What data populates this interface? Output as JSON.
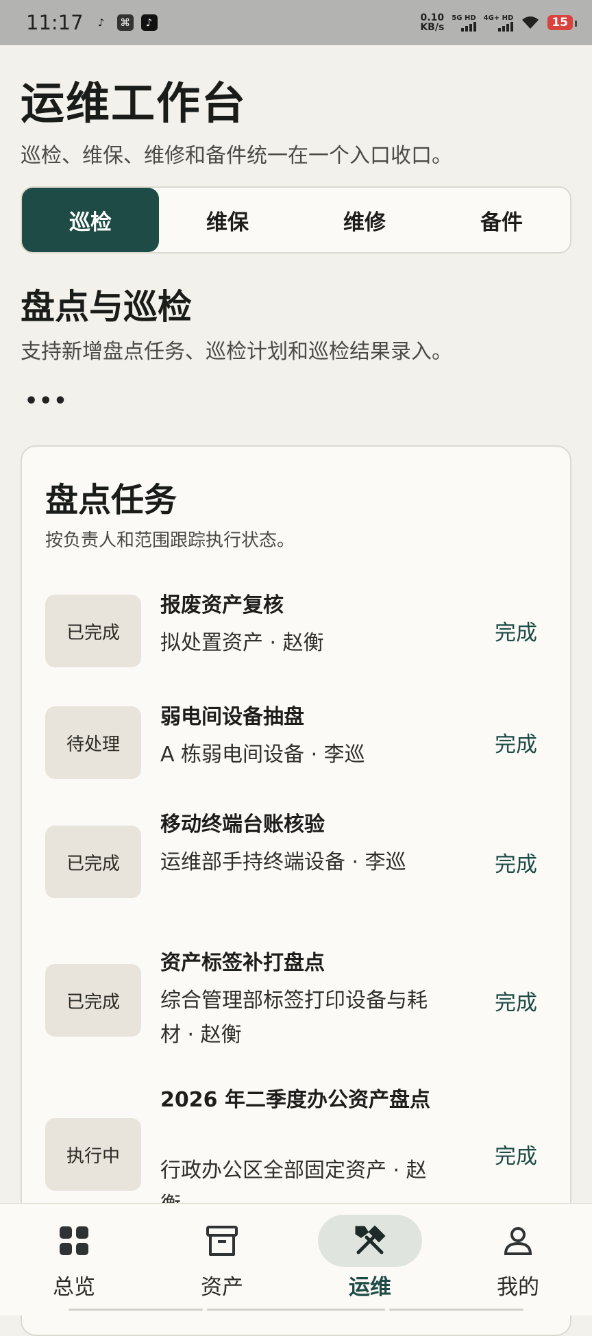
{
  "status_bar": {
    "time": "11:17",
    "net_speed_value": "0.10",
    "net_speed_unit": "KB/s",
    "sim1": "5G HD",
    "sim2": "4G+ HD",
    "battery": "15"
  },
  "page": {
    "title": "运维工作台",
    "subtitle": "巡检、维保、维修和备件统一在一个入口收口。"
  },
  "tabs": [
    {
      "label": "巡检",
      "active": true
    },
    {
      "label": "维保",
      "active": false
    },
    {
      "label": "维修",
      "active": false
    },
    {
      "label": "备件",
      "active": false
    }
  ],
  "section": {
    "title": "盘点与巡检",
    "subtitle": "支持新增盘点任务、巡检计划和巡检结果录入。",
    "more": "•••"
  },
  "card": {
    "title": "盘点任务",
    "subtitle": "按负责人和范围跟踪执行状态。",
    "tasks": [
      {
        "status": "已完成",
        "name": "报废资产复核",
        "desc": "拟处置资产 · 赵衡",
        "action": "完成"
      },
      {
        "status": "待处理",
        "name": "弱电间设备抽盘",
        "desc": "A 栋弱电间设备 · 李巡",
        "action": "完成"
      },
      {
        "status": "已完成",
        "name": "移动终端台账核验",
        "desc": "运维部手持终端设备 · 李巡",
        "action": "完成"
      },
      {
        "status": "已完成",
        "name": "资产标签补打盘点",
        "desc": "综合管理部标签打印设备与耗材 · 赵衡",
        "action": "完成"
      },
      {
        "status": "执行中",
        "name": "2026 年二季度办公资产盘点",
        "desc": "行政办公区全部固定资产 · 赵衡",
        "action": "完成"
      }
    ]
  },
  "bottom_nav": [
    {
      "label": "总览",
      "icon": "grid-icon",
      "active": false
    },
    {
      "label": "资产",
      "icon": "archive-box-icon",
      "active": false
    },
    {
      "label": "运维",
      "icon": "tools-icon",
      "active": true
    },
    {
      "label": "我的",
      "icon": "user-icon",
      "active": false
    }
  ]
}
